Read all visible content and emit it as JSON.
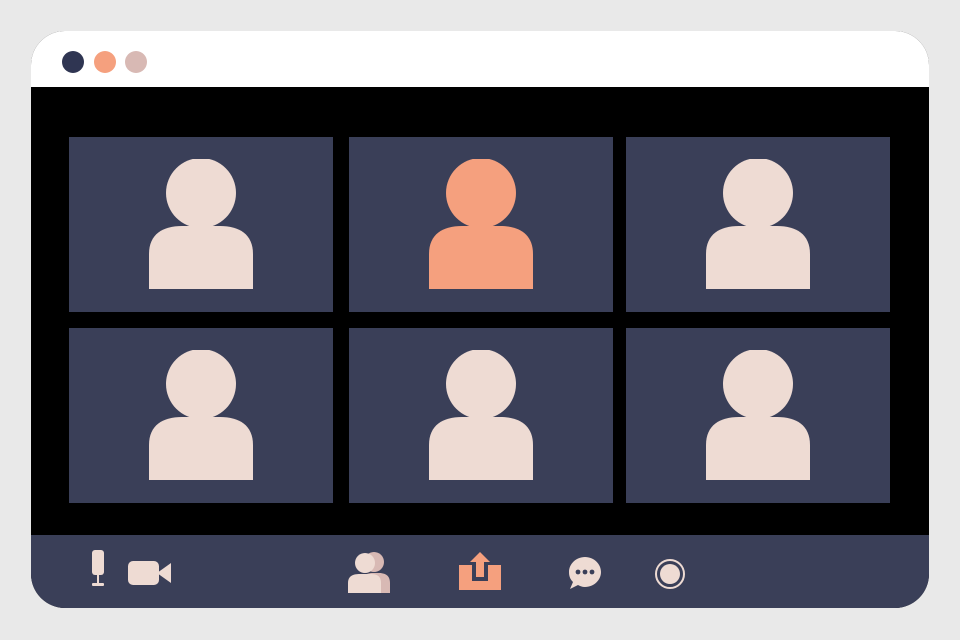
{
  "window": {
    "traffic_lights": [
      {
        "name": "close",
        "color": "#2f3552"
      },
      {
        "name": "minimize",
        "color": "#f5a07e"
      },
      {
        "name": "maximize",
        "color": "#d8b9b4"
      }
    ]
  },
  "participants": [
    {
      "icon": "participant-avatar",
      "active_speaker": false,
      "color": "#eedbd3"
    },
    {
      "icon": "participant-avatar",
      "active_speaker": true,
      "color": "#f5a07e"
    },
    {
      "icon": "participant-avatar",
      "active_speaker": false,
      "color": "#eedbd3"
    },
    {
      "icon": "participant-avatar",
      "active_speaker": false,
      "color": "#eedbd3"
    },
    {
      "icon": "participant-avatar",
      "active_speaker": false,
      "color": "#eedbd3"
    },
    {
      "icon": "participant-avatar",
      "active_speaker": false,
      "color": "#eedbd3"
    }
  ],
  "toolbar": {
    "buttons": [
      {
        "name": "microphone",
        "icon": "microphone-icon"
      },
      {
        "name": "camera",
        "icon": "video-camera-icon"
      },
      {
        "name": "participants",
        "icon": "participants-icon"
      },
      {
        "name": "share-screen",
        "icon": "share-screen-icon",
        "highlighted": true
      },
      {
        "name": "chat",
        "icon": "chat-icon"
      },
      {
        "name": "record",
        "icon": "record-icon"
      }
    ]
  },
  "colors": {
    "background": "#e9e9e9",
    "titlebar": "#ffffff",
    "stage": "#000000",
    "tile": "#3a3f58",
    "toolbar": "#3a3f58",
    "avatar": "#eedbd3",
    "accent": "#f5a07e",
    "secondary_avatar": "#d8b9b4"
  }
}
